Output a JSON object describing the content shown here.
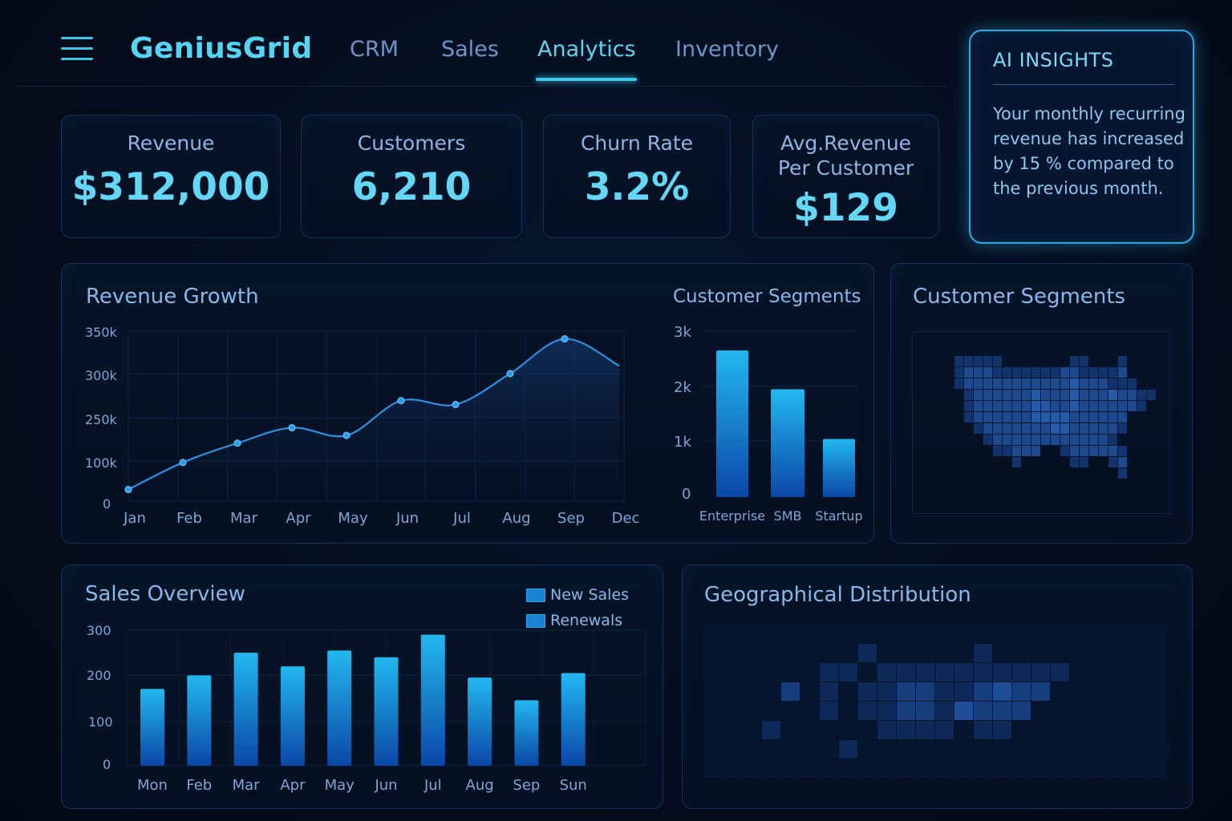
{
  "header": {
    "brand": "GeniusGrid",
    "nav": [
      {
        "label": "CRM"
      },
      {
        "label": "Sales"
      },
      {
        "label": "Analytics",
        "active": true
      },
      {
        "label": "Inventory"
      }
    ]
  },
  "kpis": [
    {
      "label": "Revenue",
      "value": "$312,000"
    },
    {
      "label": "Customers",
      "value": "6,210"
    },
    {
      "label": "Churn Rate",
      "value": "3.2%"
    },
    {
      "label": "Avg.Revenue\nPer Customer",
      "label_line1": "Avg.Revenue",
      "label_line2": "Per Customer",
      "value": "$129"
    }
  ],
  "ai_insights": {
    "title": "AI INSIGHTS",
    "text": "Your monthly recurring revenue has increased by 15 % compared to the previous month."
  },
  "panels": {
    "revenue_growth": "Revenue Growth",
    "segments_bar": "Customer Segments",
    "segments_map": "Customer Segments",
    "sales_overview": "Sales Overview",
    "geo": "Geographical Distribution"
  },
  "colors": {
    "accent": "#3fc5ec",
    "bar_top": "#1fb6f0",
    "bar_bottom": "#0a4aa8",
    "line": "#2f8fe0"
  },
  "chart_data": [
    {
      "type": "line",
      "title": "Revenue Growth",
      "x": [
        "Jan",
        "Feb",
        "Mar",
        "Apr",
        "May",
        "Jun",
        "Jul",
        "Aug",
        "Sep",
        "Dec"
      ],
      "y_ticks": [
        "350k",
        "300k",
        "250k",
        "100k",
        "0"
      ],
      "series": [
        {
          "values": [
            15,
            50,
            75,
            95,
            85,
            130,
            125,
            165,
            210,
            175
          ]
        }
      ],
      "grid": true
    },
    {
      "type": "bar",
      "title": "Customer Segments",
      "categories": [
        "Enterprise",
        "SMB",
        "Startup"
      ],
      "values": [
        2650,
        1950,
        1050
      ],
      "y_ticks": [
        "3k",
        "2k",
        "1k",
        "0"
      ],
      "ylim": [
        0,
        3000
      ]
    },
    {
      "type": "bar",
      "title": "Sales Overview",
      "categories": [
        "Mon",
        "Feb",
        "Mar",
        "Apr",
        "May",
        "Jun",
        "Jul",
        "Aug",
        "Sep",
        "Sun"
      ],
      "values": [
        170,
        200,
        250,
        220,
        255,
        240,
        290,
        195,
        145,
        205
      ],
      "y_ticks": [
        "300",
        "200",
        "100",
        "0"
      ],
      "ylim": [
        0,
        300
      ],
      "legend": [
        "New Sales",
        "Renewals"
      ],
      "legend_position": "top-right"
    }
  ]
}
